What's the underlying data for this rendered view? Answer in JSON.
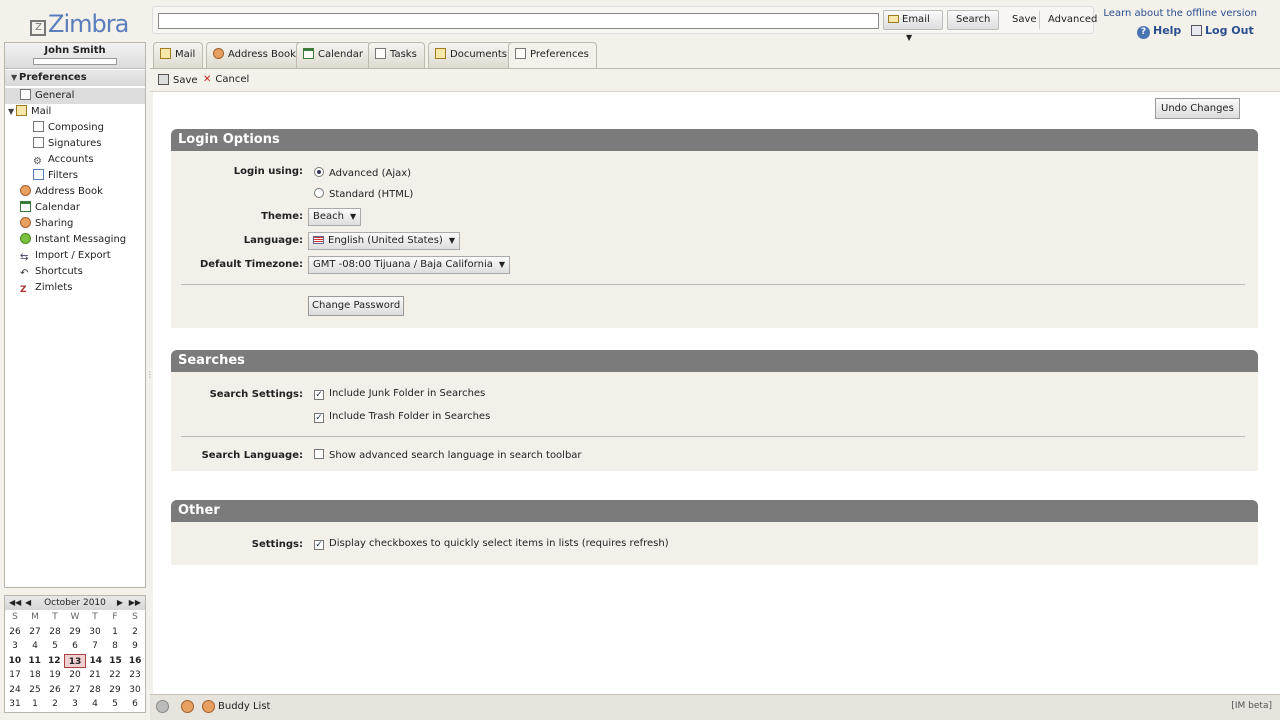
{
  "app": {
    "logo_text": "Zimbra"
  },
  "header": {
    "search_value": "",
    "search_type": "Email",
    "search_label": "Search",
    "save_label": "Save",
    "advanced_label": "Advanced",
    "offline_link": "Learn about the offline version",
    "help_label": "Help",
    "logout_label": "Log Out"
  },
  "sidebar": {
    "user_name": "John Smith",
    "section_title": "Preferences",
    "items": [
      {
        "label": "General",
        "icon": "general-icon",
        "selected": true
      },
      {
        "label": "Mail",
        "icon": "mail-icon"
      },
      {
        "label": "Composing",
        "icon": "composing-icon"
      },
      {
        "label": "Signatures",
        "icon": "signatures-icon"
      },
      {
        "label": "Accounts",
        "icon": "accounts-icon"
      },
      {
        "label": "Filters",
        "icon": "filters-icon"
      },
      {
        "label": "Address Book",
        "icon": "address-book-icon"
      },
      {
        "label": "Calendar",
        "icon": "calendar-icon"
      },
      {
        "label": "Sharing",
        "icon": "sharing-icon"
      },
      {
        "label": "Instant Messaging",
        "icon": "instant-messaging-icon"
      },
      {
        "label": "Import / Export",
        "icon": "import-export-icon"
      },
      {
        "label": "Shortcuts",
        "icon": "shortcuts-icon"
      },
      {
        "label": "Zimlets",
        "icon": "zimlets-icon"
      }
    ]
  },
  "minical": {
    "month_label": "October 2010",
    "days_of_week": [
      "S",
      "M",
      "T",
      "W",
      "T",
      "F",
      "S"
    ],
    "weeks": [
      [
        "26",
        "27",
        "28",
        "29",
        "30",
        "1",
        "2"
      ],
      [
        "3",
        "4",
        "5",
        "6",
        "7",
        "8",
        "9"
      ],
      [
        "10",
        "11",
        "12",
        "13",
        "14",
        "15",
        "16"
      ],
      [
        "17",
        "18",
        "19",
        "20",
        "21",
        "22",
        "23"
      ],
      [
        "24",
        "25",
        "26",
        "27",
        "28",
        "29",
        "30"
      ],
      [
        "31",
        "1",
        "2",
        "3",
        "4",
        "5",
        "6"
      ]
    ],
    "today": "13"
  },
  "tabs": [
    {
      "label": "Mail",
      "icon": "mail-icon"
    },
    {
      "label": "Address Book",
      "icon": "address-book-icon"
    },
    {
      "label": "Calendar",
      "icon": "calendar-icon"
    },
    {
      "label": "Tasks",
      "icon": "tasks-icon"
    },
    {
      "label": "Documents",
      "icon": "documents-icon"
    },
    {
      "label": "Preferences",
      "icon": "preferences-icon",
      "active": true
    }
  ],
  "toolbar": {
    "save_label": "Save",
    "cancel_label": "Cancel"
  },
  "content": {
    "undo_label": "Undo Changes",
    "login": {
      "title": "Login Options",
      "login_using_label": "Login using:",
      "option_advanced": "Advanced (Ajax)",
      "option_standard": "Standard (HTML)",
      "theme_label": "Theme:",
      "theme_value": "Beach",
      "language_label": "Language:",
      "language_value": "English (United States)",
      "timezone_label": "Default Timezone:",
      "timezone_value": "GMT -08:00 Tijuana / Baja California",
      "change_password_label": "Change Password"
    },
    "searches": {
      "title": "Searches",
      "settings_label": "Search Settings:",
      "junk_label": "Include Junk Folder in Searches",
      "trash_label": "Include Trash Folder in Searches",
      "language_label": "Search Language:",
      "advanced_lang_label": "Show advanced search language in search toolbar"
    },
    "other": {
      "title": "Other",
      "settings_label": "Settings:",
      "checkbox_label": "Display checkboxes to quickly select items in lists (requires refresh)"
    }
  },
  "footer": {
    "buddy_list_label": "Buddy List",
    "im_beta_label": "[IM beta]"
  },
  "colors": {
    "accent": "#2a4f8f",
    "section_header": "#7b7b7b",
    "section_bg": "#f3f0ea"
  }
}
